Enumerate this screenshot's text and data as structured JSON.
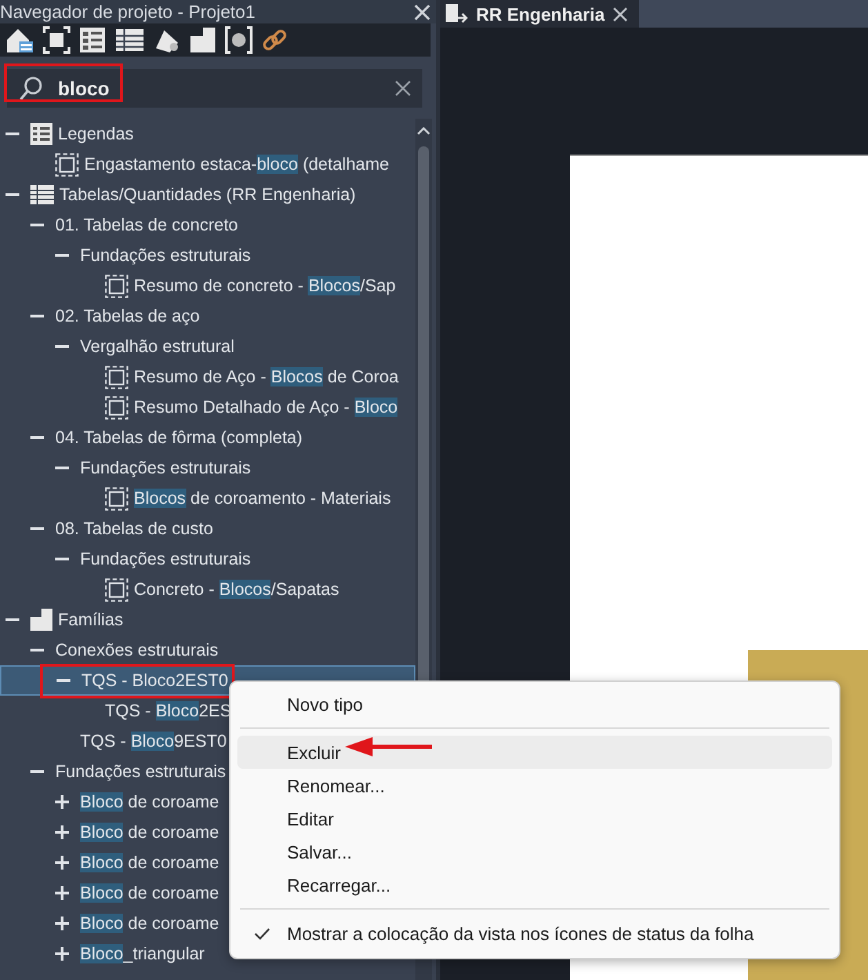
{
  "panel": {
    "title": "Navegador de projeto - Projeto1"
  },
  "search": {
    "value": "bloco"
  },
  "tree": [
    {
      "kind": "legend",
      "label": [
        {
          "text": "Legendas",
          "match": false
        }
      ],
      "expanded": true,
      "selected": false,
      "children": [
        {
          "kind": "view",
          "label": [
            {
              "text": "Engastamento estaca-",
              "match": false
            },
            {
              "text": "bloco",
              "match": true
            },
            {
              "text": " (detalhame",
              "match": false
            }
          ],
          "selected": false
        }
      ]
    },
    {
      "kind": "table",
      "label": [
        {
          "text": "Tabelas/Quantidades (RR Engenharia)",
          "match": false
        }
      ],
      "expanded": true,
      "selected": false,
      "children": [
        {
          "label": [
            {
              "text": "01. Tabelas de concreto",
              "match": false
            }
          ],
          "expanded": true,
          "selected": false,
          "children": [
            {
              "label": [
                {
                  "text": "Fundações estruturais",
                  "match": false
                }
              ],
              "expanded": true,
              "selected": false,
              "children": [
                {
                  "kind": "view",
                  "label": [
                    {
                      "text": "Resumo de concreto - ",
                      "match": false
                    },
                    {
                      "text": "Blocos",
                      "match": true
                    },
                    {
                      "text": "/Sap",
                      "match": false
                    }
                  ],
                  "selected": false
                }
              ]
            }
          ]
        },
        {
          "label": [
            {
              "text": "02. Tabelas de aço",
              "match": false
            }
          ],
          "expanded": true,
          "selected": false,
          "children": [
            {
              "label": [
                {
                  "text": "Vergalhão estrutural",
                  "match": false
                }
              ],
              "expanded": true,
              "selected": false,
              "children": [
                {
                  "kind": "view",
                  "label": [
                    {
                      "text": "Resumo de Aço - ",
                      "match": false
                    },
                    {
                      "text": "Blocos",
                      "match": true
                    },
                    {
                      "text": " de Coroa",
                      "match": false
                    }
                  ],
                  "selected": false
                },
                {
                  "kind": "view",
                  "label": [
                    {
                      "text": "Resumo Detalhado de Aço - ",
                      "match": false
                    },
                    {
                      "text": "Bloco",
                      "match": true
                    }
                  ],
                  "selected": false
                }
              ]
            }
          ]
        },
        {
          "label": [
            {
              "text": "04. Tabelas de fôrma (completa)",
              "match": false
            }
          ],
          "expanded": true,
          "selected": false,
          "children": [
            {
              "label": [
                {
                  "text": "Fundações estruturais",
                  "match": false
                }
              ],
              "expanded": true,
              "selected": false,
              "children": [
                {
                  "kind": "view",
                  "label": [
                    {
                      "text": "Blocos",
                      "match": true
                    },
                    {
                      "text": " de coroamento - Materiais",
                      "match": false
                    }
                  ],
                  "selected": false
                }
              ]
            }
          ]
        },
        {
          "label": [
            {
              "text": "08. Tabelas de custo",
              "match": false
            }
          ],
          "expanded": true,
          "selected": false,
          "children": [
            {
              "label": [
                {
                  "text": "Fundações estruturais",
                  "match": false
                }
              ],
              "expanded": true,
              "selected": false,
              "children": [
                {
                  "kind": "view",
                  "label": [
                    {
                      "text": "Concreto - ",
                      "match": false
                    },
                    {
                      "text": "Blocos",
                      "match": true
                    },
                    {
                      "text": "/Sapatas",
                      "match": false
                    }
                  ],
                  "selected": false
                }
              ]
            }
          ]
        }
      ]
    },
    {
      "kind": "family",
      "label": [
        {
          "text": "Famílias",
          "match": false
        }
      ],
      "expanded": true,
      "selected": false,
      "children": [
        {
          "label": [
            {
              "text": "Conexões estruturais",
              "match": false
            }
          ],
          "expanded": true,
          "selected": false,
          "children": [
            {
              "label": [
                {
                  "text": "TQS - Bloco2EST0",
                  "match": false
                }
              ],
              "expanded": true,
              "selected": true,
              "children": [
                {
                  "label": [
                    {
                      "text": "TQS - ",
                      "match": false
                    },
                    {
                      "text": "Bloco",
                      "match": true
                    },
                    {
                      "text": "2ES",
                      "match": false
                    }
                  ],
                  "selected": false
                }
              ]
            },
            {
              "label": [
                {
                  "text": "TQS - ",
                  "match": false
                },
                {
                  "text": "Bloco",
                  "match": true
                },
                {
                  "text": "9EST0",
                  "match": false
                }
              ],
              "selected": false
            }
          ]
        },
        {
          "label": [
            {
              "text": "Fundações estruturais",
              "match": false
            }
          ],
          "expanded": true,
          "selected": false,
          "children": [
            {
              "label": [
                {
                  "text": "Bloco",
                  "match": true
                },
                {
                  "text": " de coroame",
                  "match": false
                }
              ],
              "expanded": false,
              "selected": false
            },
            {
              "label": [
                {
                  "text": "Bloco",
                  "match": true
                },
                {
                  "text": " de coroame",
                  "match": false
                }
              ],
              "expanded": false,
              "selected": false
            },
            {
              "label": [
                {
                  "text": "Bloco",
                  "match": true
                },
                {
                  "text": " de coroame",
                  "match": false
                }
              ],
              "expanded": false,
              "selected": false
            },
            {
              "label": [
                {
                  "text": "Bloco",
                  "match": true
                },
                {
                  "text": " de coroame",
                  "match": false
                }
              ],
              "expanded": false,
              "selected": false
            },
            {
              "label": [
                {
                  "text": "Bloco",
                  "match": true
                },
                {
                  "text": " de coroame",
                  "match": false
                }
              ],
              "expanded": false,
              "selected": false
            },
            {
              "label": [
                {
                  "text": "Bloco",
                  "match": true
                },
                {
                  "text": "_triangular",
                  "match": false
                }
              ],
              "expanded": false,
              "selected": false
            }
          ]
        }
      ]
    }
  ],
  "document_tab": {
    "title": "RR Engenharia"
  },
  "context_menu": [
    {
      "kind": "item",
      "label": "Novo tipo",
      "selected": false,
      "checked": false
    },
    {
      "kind": "separator"
    },
    {
      "kind": "item",
      "label": "Excluir",
      "selected": true,
      "checked": false
    },
    {
      "kind": "item",
      "label": "Renomear...",
      "selected": false,
      "checked": false
    },
    {
      "kind": "item",
      "label": "Editar",
      "selected": false,
      "checked": false
    },
    {
      "kind": "item",
      "label": "Salvar...",
      "selected": false,
      "checked": false
    },
    {
      "kind": "item",
      "label": "Recarregar...",
      "selected": false,
      "checked": false
    },
    {
      "kind": "separator"
    },
    {
      "kind": "item",
      "label": "Mostrar a colocação da vista nos ícones de status da folha",
      "selected": false,
      "checked": true
    }
  ]
}
